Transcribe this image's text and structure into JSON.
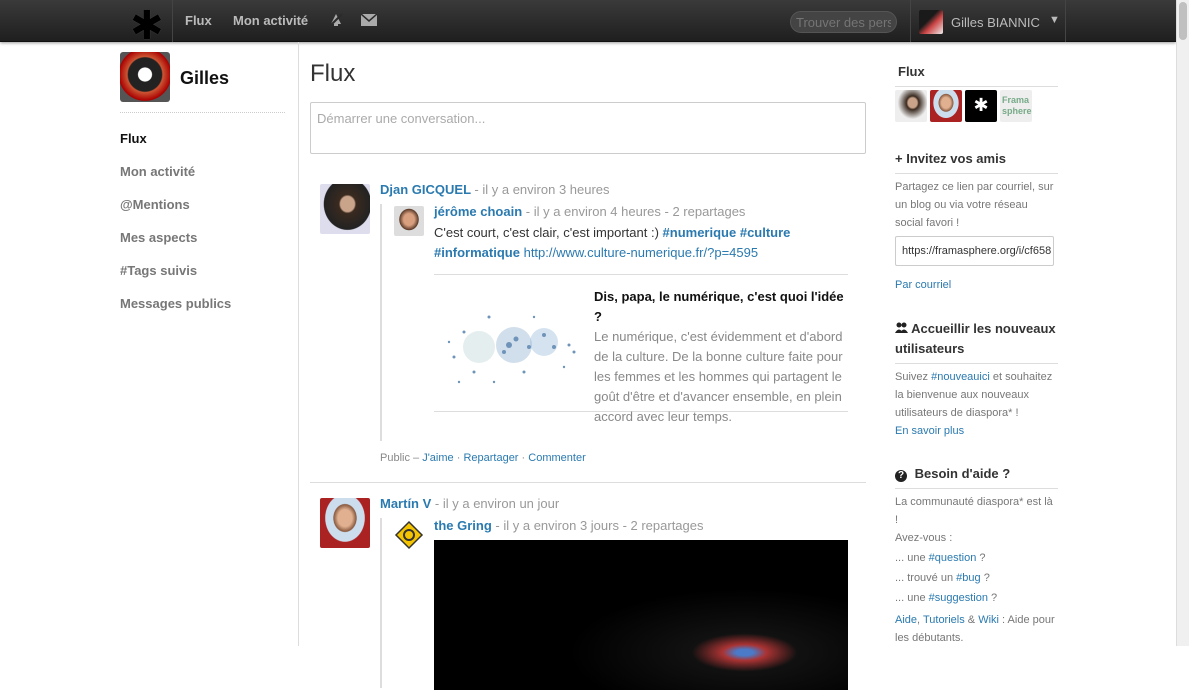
{
  "topbar": {
    "nav_stream": "Flux",
    "nav_activity": "Mon activité",
    "search_placeholder": "Trouver des personnes",
    "user_name": "Gilles BIANNIC"
  },
  "profile": {
    "name": "Gilles"
  },
  "leftnav": [
    "Flux",
    "Mon activité",
    "@Mentions",
    "Mes aspects",
    "#Tags suivis",
    "Messages publics"
  ],
  "main": {
    "title": "Flux",
    "composer_placeholder": "Démarrer une conversation..."
  },
  "posts": [
    {
      "author": "Djan GICQUEL",
      "meta": "- il y a environ 3 heures",
      "reshare": {
        "author": "jérôme choain",
        "meta": "- il y a environ 4 heures - 2 repartages",
        "text": "C'est court, c'est clair, c'est important :)",
        "tags": [
          "#numerique",
          "#culture",
          "#informatique"
        ],
        "link": "http://www.culture-numerique.fr/?p=4595",
        "og_title": "Dis, papa, le numérique, c'est quoi l'idée ?",
        "og_desc": "Le numérique, c'est évidemment et d'abord de la culture. De la bonne culture faite pour les femmes et les hommes qui partagent le goût d'être et d'avancer ensemble, en plein accord avec leur temps."
      },
      "visibility": "Public –",
      "action_like": "J'aime",
      "action_reshare": "Repartager",
      "action_comment": "Commenter"
    },
    {
      "author": "Martín V",
      "meta": "- il y a environ un jour",
      "reshare": {
        "author": "the Gring",
        "meta": "- il y a environ 3 jours - 2 repartages"
      }
    }
  ],
  "sidebar": {
    "stream_title": "Flux",
    "invite_title": "Invitez vos amis",
    "invite_text": "Partagez ce lien par courriel, sur un blog ou via votre réseau social favori !",
    "invite_link": "https://framasphere.org/i/cf658",
    "invite_email": "Par courriel",
    "welcome_title": "Accueillir les nouveaux utilisateurs",
    "welcome_pre": "Suivez",
    "welcome_tag": "#nouveauici",
    "welcome_post": "et souhaitez la bienvenue aux nouveaux utilisateurs de diaspora* !",
    "welcome_more": "En savoir plus",
    "help_title": "Besoin d'aide ?",
    "help_text": "La communauté diaspora* est là !",
    "help_avez": "Avez-vous :",
    "help_q_pre": "... une",
    "help_q_tag": "#question",
    "help_q_post": "?",
    "help_b_pre": "... trouvé un",
    "help_b_tag": "#bug",
    "help_b_post": "?",
    "help_s_pre": "... une",
    "help_s_tag": "#suggestion",
    "help_s_post": "?",
    "help_links_a": "Aide",
    "help_links_b": "Tutoriels",
    "help_links_amp": "&",
    "help_links_c": "Wiki",
    "help_links_post": ": Aide pour les débutants."
  },
  "colors": {
    "link": "#2a7ab0",
    "topbar": "#2b2b2b"
  }
}
